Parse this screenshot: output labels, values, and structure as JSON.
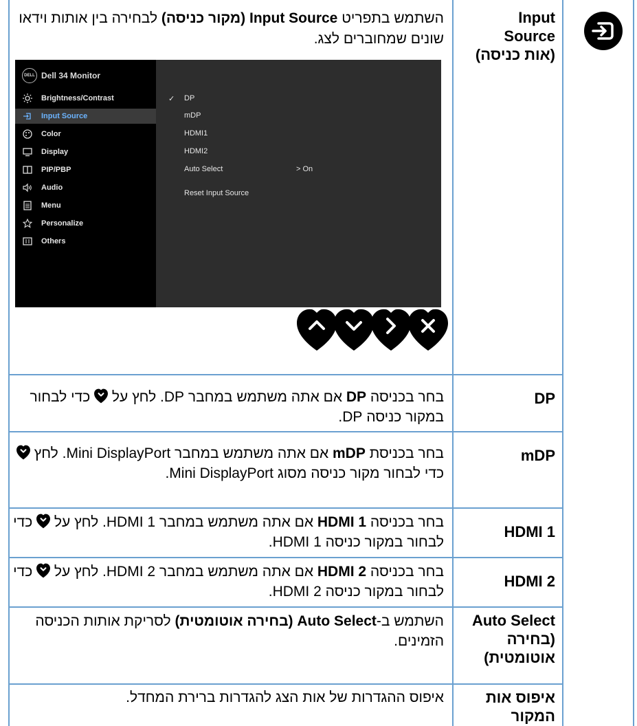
{
  "section": {
    "label_line1": "Input",
    "label_line2": "Source",
    "label_line3": "(אות כניסה)",
    "intro_a": "השתמש בתפריט ",
    "intro_b": "Input Source",
    "intro_c": " (מקור כניסה)",
    "intro_d": " לבחירה בין אותות וידאו שונים שמחוברים לצג."
  },
  "osd": {
    "title": "Dell 34 Monitor",
    "logo_text": "DELL",
    "menu": [
      {
        "label": "Brightness/Contrast",
        "icon": "brightness-icon"
      },
      {
        "label": "Input Source",
        "icon": "input-source-icon",
        "active": true
      },
      {
        "label": "Color",
        "icon": "color-icon"
      },
      {
        "label": "Display",
        "icon": "display-icon"
      },
      {
        "label": "PIP/PBP",
        "icon": "pip-pbp-icon"
      },
      {
        "label": "Audio",
        "icon": "audio-icon"
      },
      {
        "label": "Menu",
        "icon": "menu-icon"
      },
      {
        "label": "Personalize",
        "icon": "star-icon"
      },
      {
        "label": "Others",
        "icon": "others-icon"
      }
    ],
    "options": {
      "dp": "DP",
      "mdp": "mDP",
      "hdmi1": "HDMI1",
      "hdmi2": "HDMI2",
      "auto_select": "Auto Select",
      "auto_select_value": "> On",
      "reset": "Reset Input Source"
    },
    "selected_mark": "✓"
  },
  "rows": {
    "dp": {
      "label": "DP",
      "t1": "בחר בכניסה ",
      "b1": "DP",
      "t2": " אם אתה משתמש במחבר DP. לחץ על ",
      "t3": " כדי לבחור במקור כניסה DP."
    },
    "mdp": {
      "label": "mDP",
      "t1": "בחר בכניסת ",
      "b1": "mDP",
      "t2": " אם אתה משתמש במחבר Mini DisplayPort. לחץ ",
      "t3": " כדי לבחור מקור כניסה מסוג Mini DisplayPort."
    },
    "hdmi1": {
      "label": "HDMI 1",
      "t1": "בחר בכניסה ",
      "b1": "HDMI 1",
      "t2": " אם אתה משתמש במחבר HDMI 1. לחץ על ",
      "t3": " כדי לבחור במקור כניסה HDMI 1."
    },
    "hdmi2": {
      "label": "HDMI 2",
      "t1": "בחר בכניסה ",
      "b1": "HDMI 2",
      "t2": " אם אתה משתמש במחבר HDMI 2. לחץ על ",
      "t3": " כדי לבחור במקור כניסה HDMI 2."
    },
    "auto": {
      "label_line1": "Auto Select",
      "label_line2": "(בחירה",
      "label_line3": "אוטומטית)",
      "t1": "השתמש ב-",
      "b1": "Auto Select (בחירה אוטומטית)",
      "t2": " לסריקת אותות הכניסה הזמינים."
    },
    "reset": {
      "label_line1": "איפוס אות",
      "label_line2": "המקור",
      "t1": "איפוס ההגדרות של אות הצג להגדרות ברירת המחדל."
    }
  }
}
